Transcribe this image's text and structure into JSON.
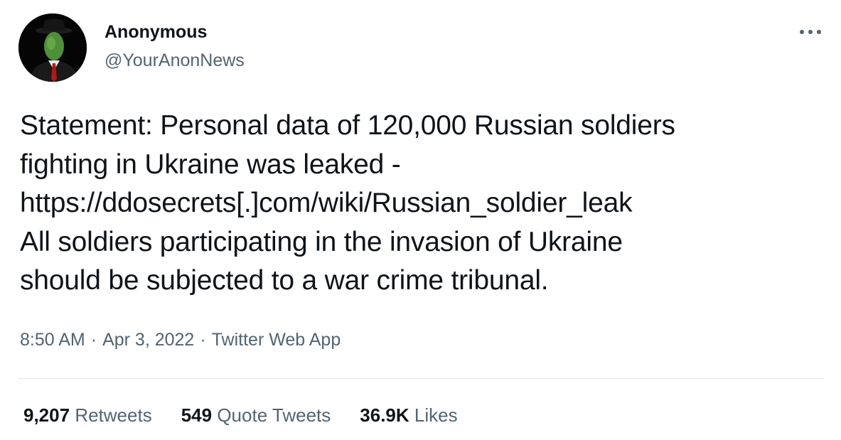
{
  "author": {
    "name": "Anonymous",
    "handle": "@YourAnonNews",
    "avatar_icon": "masked-figure-avatar"
  },
  "more_icon": "more-horizontal-icon",
  "tweet": {
    "text": "Statement: Personal data of 120,000 Russian soldiers\nfighting in Ukraine was leaked -\nhttps://ddosecrets[.]com/wiki/Russian_soldier_leak\nAll soldiers participating in the invasion of Ukraine\nshould be subjected to a war crime tribunal."
  },
  "meta": {
    "time": "8:50 AM",
    "separator": "·",
    "date": "Apr 3, 2022",
    "source": "Twitter Web App"
  },
  "stats": {
    "retweets": {
      "count": "9,207",
      "label": "Retweets"
    },
    "quotes": {
      "count": "549",
      "label": "Quote Tweets"
    },
    "likes": {
      "count": "36.9K",
      "label": "Likes"
    }
  },
  "colors": {
    "text_primary": "#0f1419",
    "text_secondary": "#536471",
    "divider": "#e3e7ea",
    "avatar_background": "#050505"
  }
}
